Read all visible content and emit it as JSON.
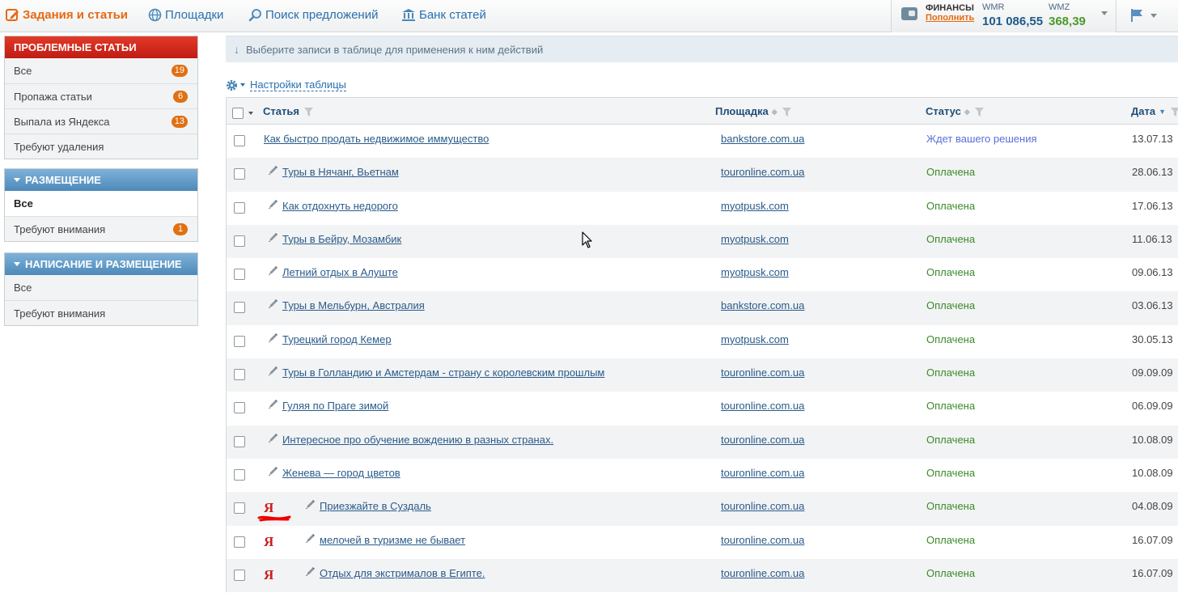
{
  "topnav": {
    "items": [
      {
        "label": "Задания и статьи",
        "icon": "edit-icon",
        "active": true
      },
      {
        "label": "Площадки",
        "icon": "globe-icon",
        "active": false
      },
      {
        "label": "Поиск предложений",
        "icon": "search-icon",
        "active": false
      },
      {
        "label": "Банк статей",
        "icon": "bank-icon",
        "active": false
      }
    ]
  },
  "finance": {
    "title": "ФИНАНСЫ",
    "topup": "Пополнить",
    "wmr_label": "WMR",
    "wmr_value": "101 086,55",
    "wmz_label": "WMZ",
    "wmz_value": "368,39",
    "wmr_color": "#1d5a8a",
    "wmz_color": "#4a9a2a"
  },
  "sidebar": {
    "problem": {
      "title": "ПРОБЛЕМНЫЕ СТАТЬИ",
      "items": [
        {
          "label": "Все",
          "count": "19"
        },
        {
          "label": "Пропажа статьи",
          "count": "6"
        },
        {
          "label": "Выпала из Яндекса",
          "count": "13"
        },
        {
          "label": "Требуют удаления",
          "count": ""
        }
      ]
    },
    "placement": {
      "title": "РАЗМЕЩЕНИЕ",
      "items": [
        {
          "label": "Все",
          "count": ""
        },
        {
          "label": "Требуют внимания",
          "count": "1"
        }
      ]
    },
    "writing": {
      "title": "НАПИСАНИЕ И РАЗМЕЩЕНИЕ",
      "items": [
        {
          "label": "Все",
          "count": ""
        },
        {
          "label": "Требуют внимания",
          "count": ""
        }
      ]
    }
  },
  "main": {
    "hint": "Выберите записи в таблице для применения к ним действий",
    "settings_label": "Настройки таблицы",
    "columns": {
      "article": "Статья",
      "site": "Площадка",
      "status": "Статус",
      "date": "Дата"
    },
    "status_colors": {
      "Ждет вашего решения": "#5b6fd6",
      "Оплачена": "#3a8a2a"
    },
    "rows": [
      {
        "title": "Как быстро продать недвижимое иммущество",
        "site": "bankstore.com.ua",
        "status": "Ждет вашего решения",
        "date": "13.07.13",
        "pen": false,
        "yandex": false
      },
      {
        "title": "Туры в Нячанг, Вьетнам",
        "site": "touronline.com.ua",
        "status": "Оплачена",
        "date": "28.06.13",
        "pen": true,
        "yandex": false
      },
      {
        "title": "Как отдохнуть недорого",
        "site": "myotpusk.com",
        "status": "Оплачена",
        "date": "17.06.13",
        "pen": true,
        "yandex": false
      },
      {
        "title": "Туры в Бейру, Мозамбик",
        "site": "myotpusk.com",
        "status": "Оплачена",
        "date": "11.06.13",
        "pen": true,
        "yandex": false
      },
      {
        "title": "Летний отдых в Алуште",
        "site": "myotpusk.com",
        "status": "Оплачена",
        "date": "09.06.13",
        "pen": true,
        "yandex": false
      },
      {
        "title": "Туры в Мельбурн, Австралия",
        "site": "bankstore.com.ua",
        "status": "Оплачена",
        "date": "03.06.13",
        "pen": true,
        "yandex": false
      },
      {
        "title": "Турецкий город Кемер",
        "site": "myotpusk.com",
        "status": "Оплачена",
        "date": "30.05.13",
        "pen": true,
        "yandex": false
      },
      {
        "title": "Туры в Голландию и Амстердам - страну с королевским прошлым",
        "site": "touronline.com.ua",
        "status": "Оплачена",
        "date": "09.09.09",
        "pen": true,
        "yandex": false
      },
      {
        "title": "Гуляя по Праге зимой",
        "site": "touronline.com.ua",
        "status": "Оплачена",
        "date": "06.09.09",
        "pen": true,
        "yandex": false
      },
      {
        "title": "Интересное про обучение вождению в разных странах.",
        "site": "touronline.com.ua",
        "status": "Оплачена",
        "date": "10.08.09",
        "pen": true,
        "yandex": false
      },
      {
        "title": "Женева — город цветов",
        "site": "touronline.com.ua",
        "status": "Оплачена",
        "date": "10.08.09",
        "pen": true,
        "yandex": false
      },
      {
        "title": "Приезжайте в Суздаль",
        "site": "touronline.com.ua",
        "status": "Оплачена",
        "date": "04.08.09",
        "pen": true,
        "yandex": true,
        "yandex_mark": "Я"
      },
      {
        "title": "мелочей в туризме не бывает",
        "site": "touronline.com.ua",
        "status": "Оплачена",
        "date": "16.07.09",
        "pen": true,
        "yandex": true,
        "yandex_mark": "Я"
      },
      {
        "title": "Отдых для экстрималов в Египте.",
        "site": "touronline.com.ua",
        "status": "Оплачена",
        "date": "16.07.09",
        "pen": true,
        "yandex": true,
        "yandex_mark": "Я"
      }
    ]
  }
}
